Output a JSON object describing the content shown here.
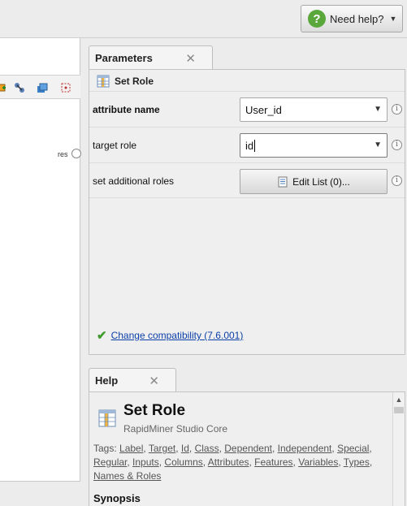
{
  "header": {
    "need_help_label": "Need help?",
    "help_icon_glyph": "?"
  },
  "canvas": {
    "port_label": "res",
    "toolbar_icons": [
      "add-icon",
      "connect-icon",
      "layers-icon",
      "select-icon"
    ]
  },
  "parameters": {
    "tab_label": "Parameters",
    "close_glyph": "✕",
    "operator_name": "Set Role",
    "rows": [
      {
        "label": "attribute name",
        "value": "User_id",
        "type": "select"
      },
      {
        "label": "target role",
        "value": "id",
        "type": "combobox"
      },
      {
        "label": "set additional roles",
        "button_label": "Edit List (0)...",
        "type": "button"
      }
    ],
    "info_glyph": "i",
    "compat_link": "Change compatibility (7.6.001)"
  },
  "help": {
    "tab_label": "Help",
    "close_glyph": "✕",
    "title": "Set Role",
    "subtitle": "RapidMiner Studio Core",
    "tags_prefix": "Tags:",
    "tags": [
      "Label",
      "Target",
      "Id",
      "Class",
      "Dependent",
      "Independent",
      "Special",
      "Regular",
      "Inputs",
      "Columns",
      "Attributes",
      "Features",
      "Variables",
      "Types",
      "Names & Roles"
    ],
    "synopsis_heading": "Synopsis"
  },
  "colors": {
    "accent_green": "#5aa83c",
    "link_blue": "#0b3fa8",
    "panel_bg": "#efefef"
  }
}
